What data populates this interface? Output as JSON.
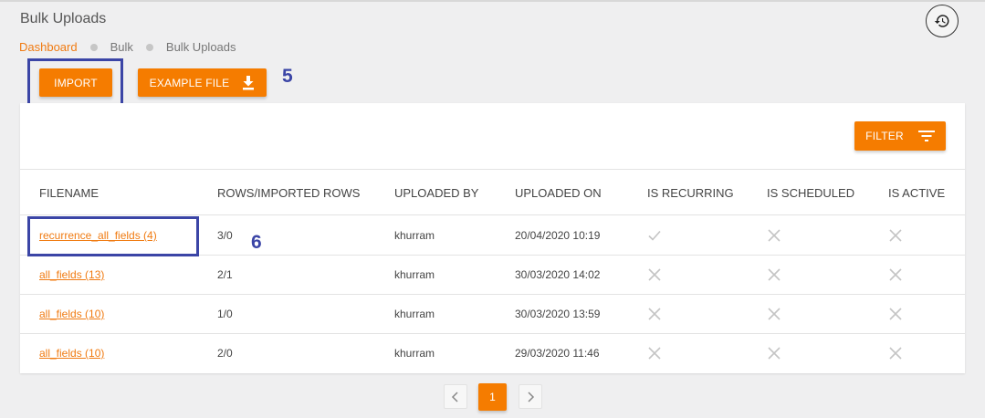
{
  "header": {
    "title": "Bulk Uploads",
    "history_icon": "history-icon"
  },
  "breadcrumb": [
    "Dashboard",
    "Bulk",
    "Bulk Uploads"
  ],
  "toolbar": {
    "import_label": "IMPORT",
    "example_label": "EXAMPLE FILE",
    "example_icon": "download-icon",
    "filter_label": "FILTER",
    "filter_icon": "filter-icon"
  },
  "annotations": {
    "five": "5",
    "six": "6"
  },
  "table": {
    "columns": [
      "FILENAME",
      "ROWS/IMPORTED ROWS",
      "UPLOADED BY",
      "UPLOADED ON",
      "IS RECURRING",
      "IS SCHEDULED",
      "IS ACTIVE"
    ],
    "rows": [
      {
        "filename": "recurrence_all_fields (4)",
        "rows": "3/0",
        "uploaded_by": "khurram",
        "uploaded_on": "20/04/2020 10:19",
        "is_recurring": true,
        "is_scheduled": false,
        "is_active": false
      },
      {
        "filename": "all_fields (13)",
        "rows": "2/1",
        "uploaded_by": "khurram",
        "uploaded_on": "30/03/2020 14:02",
        "is_recurring": false,
        "is_scheduled": false,
        "is_active": false
      },
      {
        "filename": "all_fields (10)",
        "rows": "1/0",
        "uploaded_by": "khurram",
        "uploaded_on": "30/03/2020 13:59",
        "is_recurring": false,
        "is_scheduled": false,
        "is_active": false
      },
      {
        "filename": "all_fields (10)",
        "rows": "2/0",
        "uploaded_by": "khurram",
        "uploaded_on": "29/03/2020 11:46",
        "is_recurring": false,
        "is_scheduled": false,
        "is_active": false
      }
    ]
  },
  "pagination": {
    "current_page": "1"
  },
  "colors": {
    "accent": "#f57c00",
    "annotation": "#3b45a6",
    "icon_gray": "#c4c4c4"
  }
}
